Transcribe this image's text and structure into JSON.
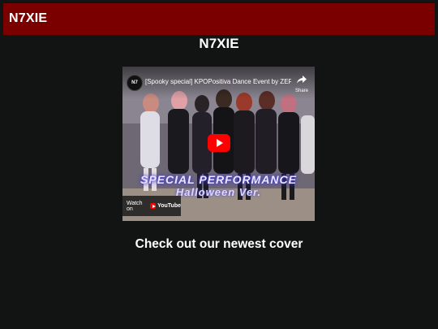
{
  "header": {
    "brand": "N7XIE"
  },
  "main": {
    "title": "N7XIE",
    "caption": "Check out our newest cover",
    "video": {
      "channel_badge": "N7",
      "title": "[Spooky special] KPOPositiva Dance Event by ZERO...",
      "share_label": "Share",
      "overlay_line1": "SPECIAL PERFORMANCE",
      "overlay_line2": "Halloween Ver.",
      "watch_on_label": "Watch on",
      "platform_name": "YouTube"
    }
  },
  "colors": {
    "header_bg": "#7a0000",
    "page_bg": "#121413",
    "play_button": "#ff0000"
  }
}
